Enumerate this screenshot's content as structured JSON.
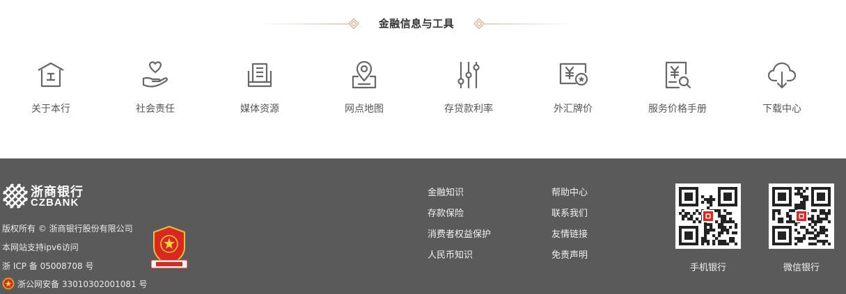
{
  "section": {
    "title": "金融信息与工具"
  },
  "tools": [
    {
      "label": "关于本行",
      "icon": "house-icon"
    },
    {
      "label": "社会责任",
      "icon": "heart-hand-icon"
    },
    {
      "label": "媒体资源",
      "icon": "book-icon"
    },
    {
      "label": "网点地图",
      "icon": "map-pin-icon"
    },
    {
      "label": "存贷款利率",
      "icon": "sliders-icon"
    },
    {
      "label": "外汇牌价",
      "icon": "yen-card-icon"
    },
    {
      "label": "服务价格手册",
      "icon": "yen-search-icon"
    },
    {
      "label": "下载中心",
      "icon": "cloud-download-icon"
    }
  ],
  "footer": {
    "logo_cn": "浙商银行",
    "logo_en": "CZBANK",
    "copyright": "版权所有 © 浙商银行股份有限公司",
    "ipv6": "本网站支持ipv6访问",
    "icp": "浙 ICP 备 05008708 号",
    "police": "浙公网安备 33010302001081 号",
    "links_col1": [
      "金融知识",
      "存款保险",
      "消费者权益保护",
      "人民币知识"
    ],
    "links_col2": [
      "帮助中心",
      "联系我们",
      "友情链接",
      "免责声明"
    ],
    "qr_mobile_label": "手机银行",
    "qr_wechat_label": "微信银行",
    "colors": {
      "footer_bg": "#5b5a5b",
      "accent_line": "#d6a882",
      "icon_gray": "#666666",
      "qr_red": "#d9281f"
    }
  }
}
